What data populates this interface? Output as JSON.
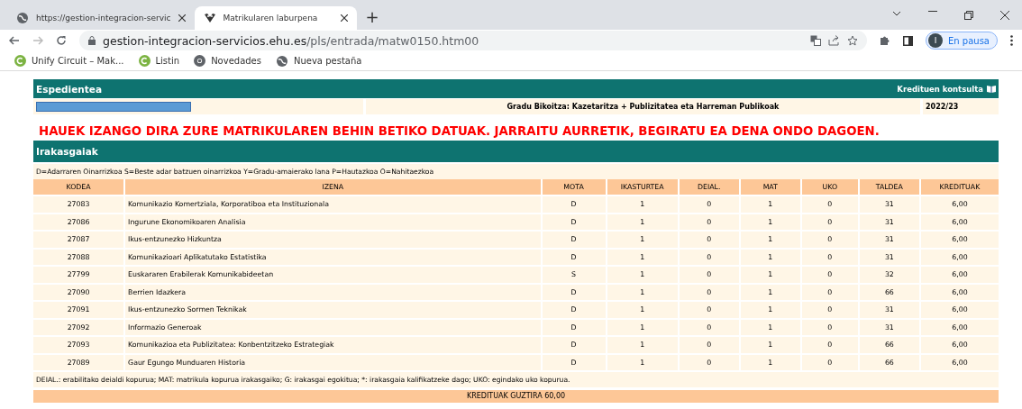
{
  "browser": {
    "tabs": [
      {
        "title": "https://gestion-integracion-servic",
        "selected": false
      },
      {
        "title": "Matrikularen laburpena",
        "selected": true
      }
    ],
    "new_tab": "+",
    "url": {
      "host": "gestion-integracion-servicios.ehu.es",
      "path": "/pls/entrada/matw0150.htm00"
    },
    "profile": {
      "initial": "I",
      "status": "En pausa"
    },
    "bookmarks": [
      {
        "label": "Unify Circuit – Mak..."
      },
      {
        "label": "Listin"
      },
      {
        "label": "Novedades"
      },
      {
        "label": "Nueva pestaña"
      }
    ]
  },
  "record": {
    "title": "Espedientea",
    "credits_link": "Kredituen kontsulta",
    "student_redacted": true,
    "degree": "Gradu Bikoitza: Kazetaritza + Publizitatea eta Harreman Publikoak",
    "year": "2022/23"
  },
  "warning": "HAUEK IZANGO DIRA ZURE MATRIKULAREN BEHIN BETIKO DATUAK. JARRAITU AURRETIK, BEGIRATU EA DENA ONDO DAGOEN.",
  "subjects": {
    "title": "Irakasgaiak",
    "legend": "D=Adarraren Oinarrizkoa S=Beste adar batzuen oinarrizkoa Y=Gradu-amaierako lana P=Hautazkoa O=Nahitaezkoa",
    "columns": [
      "KODEA",
      "IZENA",
      "MOTA",
      "IKASTURTEA",
      "DEIAL.",
      "MAT",
      "UKO",
      "TALDEA",
      "KREDITUAK"
    ],
    "rows": [
      [
        "27083",
        "Komunikazio Komertziala, Korporatiboa eta Instituzionala",
        "D",
        "1",
        "0",
        "1",
        "0",
        "31",
        "6,00"
      ],
      [
        "27086",
        "Ingurune Ekonomikoaren Analisia",
        "D",
        "1",
        "0",
        "1",
        "0",
        "31",
        "6,00"
      ],
      [
        "27087",
        "Ikus-entzunezko Hizkuntza",
        "D",
        "1",
        "0",
        "1",
        "0",
        "31",
        "6,00"
      ],
      [
        "27088",
        "Komunikazioari Aplikatutako Estatistika",
        "D",
        "1",
        "0",
        "1",
        "0",
        "31",
        "6,00"
      ],
      [
        "27799",
        "Euskararen Erabilerak Komunikabideetan",
        "S",
        "1",
        "0",
        "1",
        "0",
        "32",
        "6,00"
      ],
      [
        "27090",
        "Berrien Idazkera",
        "D",
        "1",
        "0",
        "1",
        "0",
        "66",
        "6,00"
      ],
      [
        "27091",
        "Ikus-entzunezko Sormen Teknikak",
        "D",
        "1",
        "0",
        "1",
        "0",
        "31",
        "6,00"
      ],
      [
        "27092",
        "Informazio Generoak",
        "D",
        "1",
        "0",
        "1",
        "0",
        "31",
        "6,00"
      ],
      [
        "27093",
        "Komunikazioa eta Publizitatea: Konbentzitzeko Estrategiak",
        "D",
        "1",
        "0",
        "1",
        "0",
        "66",
        "6,00"
      ],
      [
        "27089",
        "Gaur Egungo Munduaren Historia",
        "D",
        "1",
        "0",
        "1",
        "0",
        "66",
        "6,00"
      ]
    ],
    "footnote": "DEIAL.: erabilitako deialdi kopurua; MAT: matrikula kopurua irakasgaiko; G: irakasgai egokitua; *: irakasgaia kalifikatzeke dago; UKO: egindako uko kopurua.",
    "total": "KREDITUAK GUZTIRA 60,00"
  }
}
